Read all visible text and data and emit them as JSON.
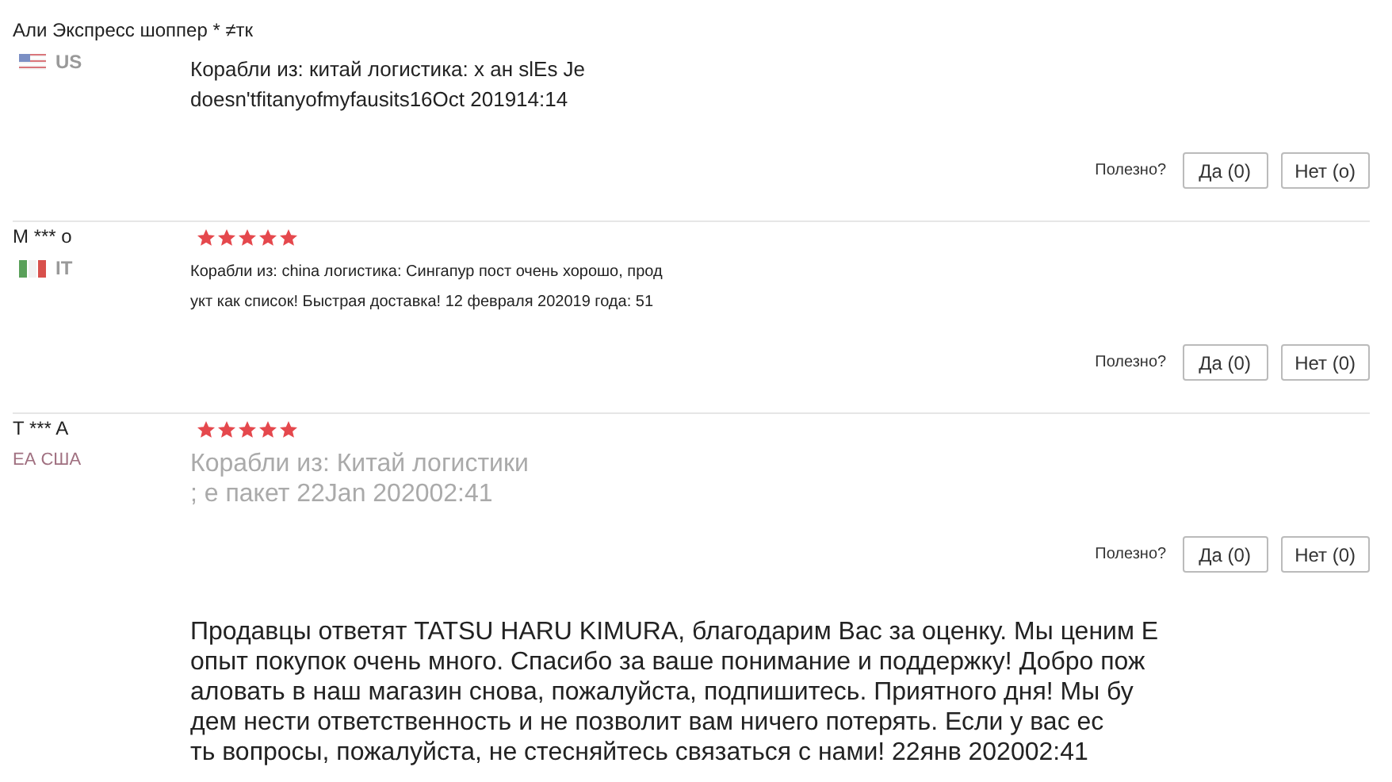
{
  "reviews": [
    {
      "name": "Али Экспресс шоппер * ≠тк",
      "country": {
        "kind": "us",
        "label": "US"
      },
      "text": {
        "kind": "plain",
        "lines": [
          "Корабли из: китай логистика: x ан slEs Je",
          "doesn'tfitanyofmyfausits16Oct 201914:14"
        ]
      },
      "helpful": {
        "label": "Полезно?",
        "yes": "Да (0)",
        "no": "Нет (o)"
      }
    },
    {
      "name": "M *** o",
      "country": {
        "kind": "it",
        "label": "IT"
      },
      "stars": 5,
      "text": {
        "kind": "compact",
        "lines": [
          "Корабли из: china логистика: Сингапур пост очень хорошо, прод",
          "укт как список! Быстрая доставка! 12 февраля 202019 года: 51"
        ]
      },
      "helpful": {
        "label": "Полезно?",
        "yes": "Да (0)",
        "no": "Нет (0)"
      }
    },
    {
      "name": "T *** A",
      "country": {
        "kind": "text",
        "label": "ЕА США"
      },
      "stars": 5,
      "text": {
        "kind": "faded",
        "lines": [
          "Корабли из: Китай логистики",
          "; е пакет 22Jan 202002:41"
        ]
      },
      "helpful": {
        "label": "Полезно?",
        "yes": "Да (0)",
        "no": "Нет (0)"
      }
    }
  ],
  "seller_reply": [
    "Продавцы ответят TATSU HARU KIMURA, благодарим Вас за оценку. Мы ценим Е",
    "опыт покупок очень много. Спасибо за ваше понимание и поддержку! Добро пож",
    "аловать в наш магазин снова, пожалуйста, подпишитесь. Приятного дня! Мы бу",
    "дем нести ответственность и не позволит вам ничего потерять. Если у вас ес",
    "ть вопросы, пожалуйста, не стесняйтесь связаться с нами! 22янв 202002:41"
  ]
}
